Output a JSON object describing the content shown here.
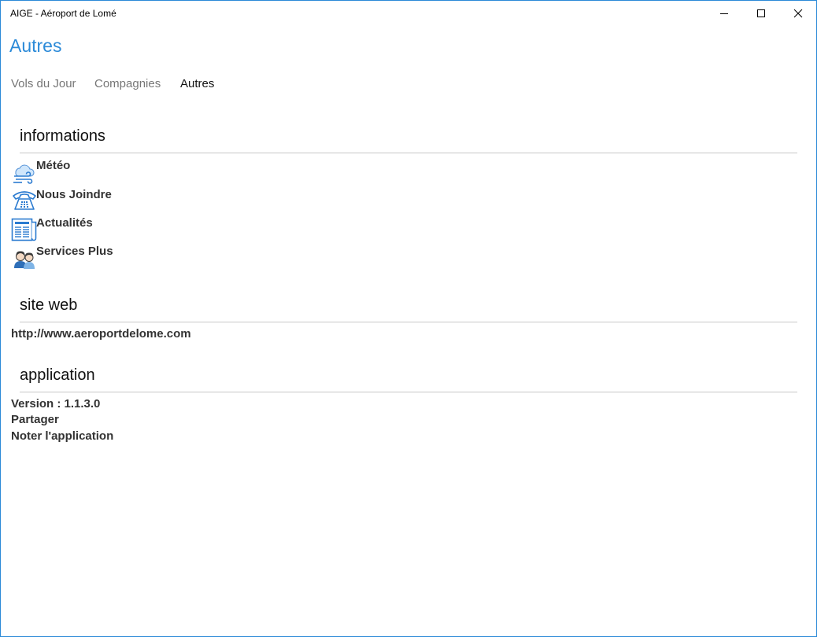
{
  "window": {
    "title": "AIGE - Aéroport de Lomé",
    "controls": {
      "minimize": "minimize-icon",
      "maximize": "maximize-icon",
      "close": "close-icon"
    },
    "accent_color": "#2b8ad8"
  },
  "page": {
    "title": "Autres"
  },
  "tabs": [
    {
      "label": "Vols du Jour",
      "active": false
    },
    {
      "label": "Compagnies",
      "active": false
    },
    {
      "label": "Autres",
      "active": true
    }
  ],
  "sections": {
    "informations": {
      "heading": "informations",
      "items": [
        {
          "label": "Météo",
          "icon": "weather-icon"
        },
        {
          "label": "Nous Joindre",
          "icon": "telephone-icon"
        },
        {
          "label": "Actualités",
          "icon": "newspaper-icon"
        },
        {
          "label": "Services Plus",
          "icon": "people-icon"
        }
      ]
    },
    "site_web": {
      "heading": "site web",
      "url": "http://www.aeroportdelome.com"
    },
    "application": {
      "heading": "application",
      "version": "Version : 1.1.3.0",
      "share": "Partager",
      "rate": "Noter l'application"
    }
  }
}
